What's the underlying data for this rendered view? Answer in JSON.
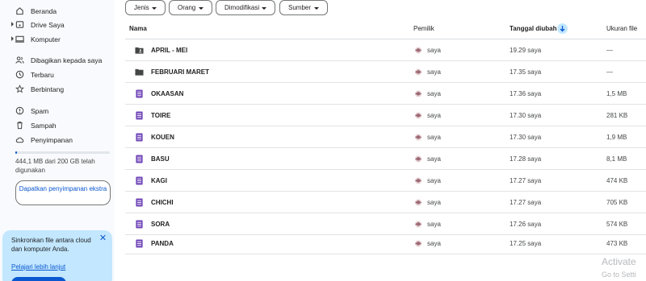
{
  "sidebar": {
    "items": [
      {
        "label": "Beranda",
        "icon": "home-icon"
      },
      {
        "label": "Drive Saya",
        "icon": "drive-icon"
      },
      {
        "label": "Komputer",
        "icon": "computer-icon"
      },
      {
        "label": "Dibagikan kepada saya",
        "icon": "shared-icon"
      },
      {
        "label": "Terbaru",
        "icon": "clock-icon"
      },
      {
        "label": "Berbintang",
        "icon": "star-icon"
      },
      {
        "label": "Spam",
        "icon": "spam-icon"
      },
      {
        "label": "Sampah",
        "icon": "trash-icon"
      },
      {
        "label": "Penyimpanan",
        "icon": "cloud-icon"
      }
    ],
    "storage_used_fraction": 0.02,
    "storage_text": "444,1 MB dari 200 GB telah digunakan",
    "upgrade_label": "Dapatkan penyimpanan ekstra",
    "sync_card": {
      "text": "Sinkronkan file antara cloud dan komputer Anda.",
      "link": "Pelajari lebih lanjut"
    }
  },
  "filters": [
    "Jenis",
    "Orang",
    "Dimodifikasi",
    "Sumber"
  ],
  "table": {
    "headers": {
      "name": "Nama",
      "owner": "Pemilik",
      "date": "Tanggal diubah",
      "size": "Ukuran file"
    },
    "rows": [
      {
        "name": "APRIL - MEI",
        "type": "shared-folder",
        "owner": "saya",
        "date": "19.29 saya",
        "size": "—"
      },
      {
        "name": "FEBRUARI MARET",
        "type": "folder",
        "owner": "saya",
        "date": "17.35 saya",
        "size": "—"
      },
      {
        "name": "OKAASAN",
        "type": "form",
        "owner": "saya",
        "date": "17.36 saya",
        "size": "1,5 MB"
      },
      {
        "name": "TOIRE",
        "type": "form",
        "owner": "saya",
        "date": "17.30 saya",
        "size": "281 KB"
      },
      {
        "name": "KOUEN",
        "type": "form",
        "owner": "saya",
        "date": "17.30 saya",
        "size": "1,9 MB"
      },
      {
        "name": "BASU",
        "type": "form",
        "owner": "saya",
        "date": "17.28 saya",
        "size": "8,1 MB"
      },
      {
        "name": "KAGI",
        "type": "form",
        "owner": "saya",
        "date": "17.27 saya",
        "size": "474 KB"
      },
      {
        "name": "CHICHI",
        "type": "form",
        "owner": "saya",
        "date": "17.27 saya",
        "size": "705 KB"
      },
      {
        "name": "SORA",
        "type": "form",
        "owner": "saya",
        "date": "17.26 saya",
        "size": "574 KB"
      },
      {
        "name": "PANDA",
        "type": "form",
        "owner": "saya",
        "date": "17.25 saya",
        "size": "473 KB"
      }
    ]
  },
  "watermark": {
    "line1": "Activate",
    "line2": "Go to Setti"
  },
  "colors": {
    "accent": "#0b57d0",
    "form_icon": "#7248b9",
    "folder_icon": "#444746",
    "sync_card_bg": "#c2e7ff"
  }
}
